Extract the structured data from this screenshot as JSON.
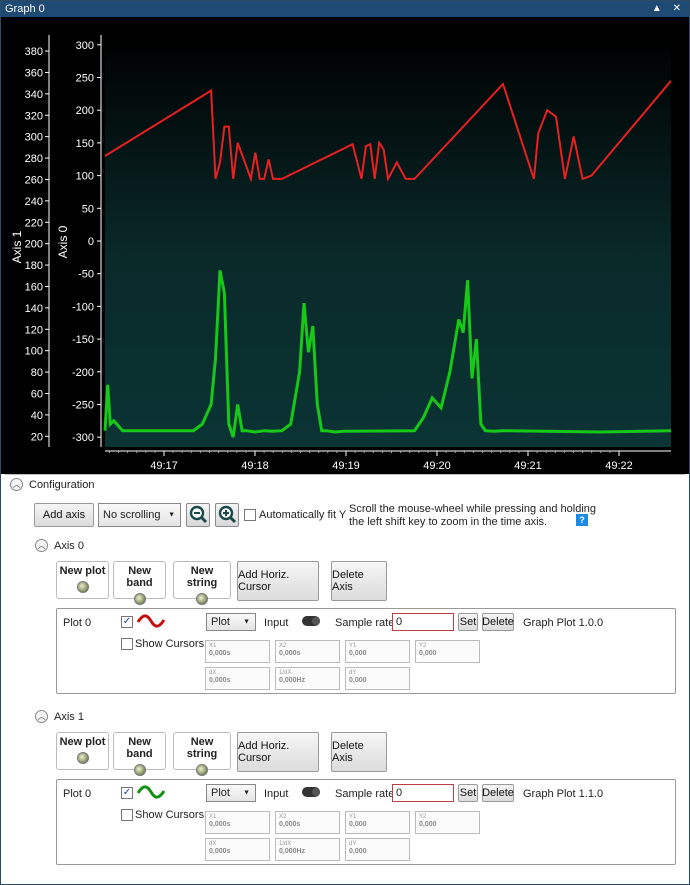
{
  "window": {
    "title": "Graph 0",
    "buttons": [
      "▲",
      "✕"
    ]
  },
  "chart_data": {
    "type": "line",
    "x_ticks": [
      "49:17",
      "49:18",
      "49:19",
      "49:20",
      "49:21",
      "49:22"
    ],
    "axes": [
      {
        "name": "Axis 1",
        "ticks": [
          20,
          40,
          60,
          80,
          100,
          120,
          140,
          160,
          180,
          200,
          220,
          240,
          260,
          280,
          300,
          320,
          340,
          360,
          380
        ],
        "ylim": [
          10,
          395
        ]
      },
      {
        "name": "Axis 0",
        "ticks": [
          300,
          250,
          200,
          150,
          100,
          50,
          0,
          -50,
          -100,
          -150,
          -200,
          -250,
          -300
        ],
        "ylim": [
          -315,
          315
        ]
      }
    ],
    "series": [
      {
        "color": "#e82020",
        "axis": "Axis 0",
        "x": [
          0,
          12,
          12.5,
          13,
          13.5,
          14,
          14.5,
          15,
          16.5,
          17,
          17.5,
          18,
          18.5,
          19,
          20,
          28,
          29,
          29.5,
          30,
          30.5,
          31,
          31.5,
          32,
          33,
          34,
          35,
          45,
          48.5,
          49,
          50,
          51,
          52,
          53,
          54,
          55,
          64
        ],
        "y": [
          130,
          230,
          95,
          120,
          175,
          175,
          95,
          150,
          95,
          135,
          95,
          95,
          125,
          95,
          95,
          148,
          95,
          145,
          148,
          95,
          150,
          140,
          95,
          120,
          95,
          95,
          240,
          95,
          165,
          200,
          190,
          95,
          160,
          95,
          100,
          245
        ]
      },
      {
        "color": "#18c818",
        "axis": "Axis 0",
        "x": [
          0,
          0.3,
          0.6,
          1,
          2,
          10,
          11,
          12,
          12.5,
          13,
          13.5,
          14,
          14.5,
          15,
          15.5,
          16,
          17,
          18,
          19,
          20,
          21,
          22,
          22.5,
          23,
          23.5,
          24,
          24.5,
          25,
          26,
          27,
          35,
          36,
          37,
          38,
          39,
          40,
          40.5,
          41,
          41.5,
          42,
          42.5,
          43,
          44,
          45,
          56,
          64
        ],
        "y": [
          -290,
          -220,
          -280,
          -275,
          -290,
          -290,
          -280,
          -250,
          -180,
          -45,
          -80,
          -280,
          -300,
          -250,
          -290,
          -290,
          -292,
          -290,
          -291,
          -290,
          -280,
          -200,
          -95,
          -170,
          -130,
          -250,
          -290,
          -290,
          -292,
          -291,
          -290,
          -270,
          -240,
          -255,
          -200,
          -120,
          -140,
          -60,
          -210,
          -150,
          -280,
          -290,
          -291,
          -290,
          -292,
          -290
        ]
      }
    ]
  },
  "config": {
    "title": "Configuration",
    "add_axis": "Add axis",
    "scroll_mode": "No scrolling",
    "auto_fit": "Automatically fit Y",
    "help_text_1": "Scroll the mouse-wheel while pressing and holding",
    "help_text_2": "the left shift key to zoom in the time axis.",
    "help_icon": "?"
  },
  "axes_panels": [
    {
      "title": "Axis 0",
      "new_plot": "New plot",
      "new_band": "New band",
      "new_string": "New string",
      "add_cursor": "Add Horiz. Cursor",
      "delete_axis": "Delete Axis",
      "plot": {
        "name": "Plot 0",
        "show_cursors": "Show Cursors",
        "type": "Plot",
        "input": "Input",
        "sample_rate_label": "Sample rate",
        "sample_rate": "0",
        "set": "Set",
        "delete": "Delete",
        "graph_plot": "Graph Plot 1.0.0",
        "color": "#c01010",
        "fields": [
          {
            "k": "X1",
            "v": "0,000s"
          },
          {
            "k": "X2",
            "v": "0,000s"
          },
          {
            "k": "Y1",
            "v": "0,000"
          },
          {
            "k": "Y2",
            "v": "0,000"
          },
          {
            "k": "dX",
            "v": "0,000s"
          },
          {
            "k": "1/dX",
            "v": "0,000Hz"
          },
          {
            "k": "dY",
            "v": "0,000"
          }
        ]
      }
    },
    {
      "title": "Axis 1",
      "new_plot": "New plot",
      "new_band": "New band",
      "new_string": "New string",
      "add_cursor": "Add Horiz. Cursor",
      "delete_axis": "Delete Axis",
      "plot": {
        "name": "Plot 0",
        "show_cursors": "Show Cursors",
        "type": "Plot",
        "input": "Input",
        "sample_rate_label": "Sample rate",
        "sample_rate": "0",
        "set": "Set",
        "delete": "Delete",
        "graph_plot": "Graph Plot 1.1.0",
        "color": "#10a010",
        "fields": [
          {
            "k": "X1",
            "v": "0,000s"
          },
          {
            "k": "X2",
            "v": "0,000s"
          },
          {
            "k": "Y1",
            "v": "0,000"
          },
          {
            "k": "Y2",
            "v": "0,000"
          },
          {
            "k": "dX",
            "v": "0,000s"
          },
          {
            "k": "1/dX",
            "v": "0,000Hz"
          },
          {
            "k": "dY",
            "v": "0,000"
          }
        ]
      }
    }
  ]
}
